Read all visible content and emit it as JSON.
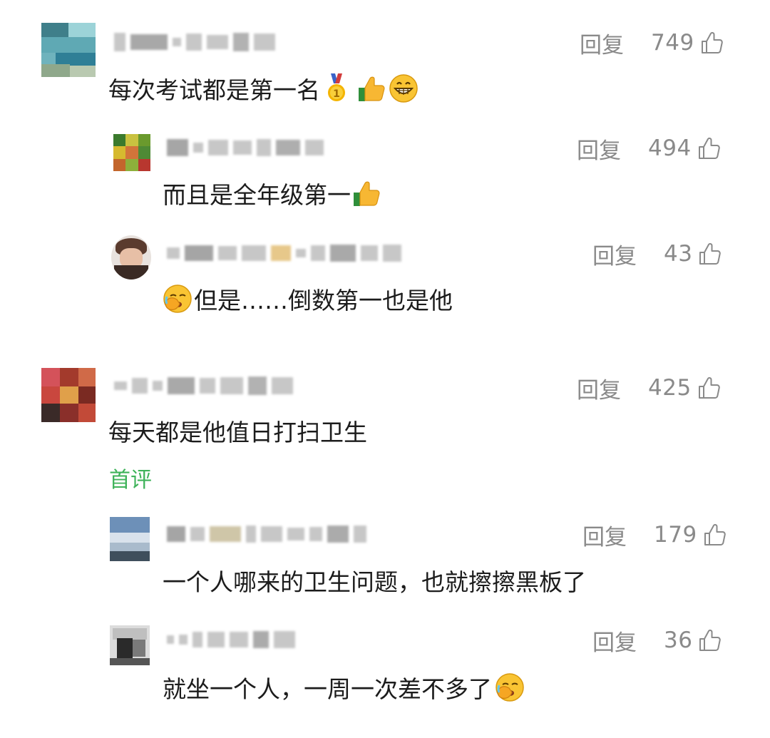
{
  "ui": {
    "reply_label": "回复",
    "first_comment_tag": "首评",
    "colors": {
      "meta_gray": "#8a8a8a",
      "tag_green": "#3fb35a",
      "text": "#1c1c1c"
    }
  },
  "comments": [
    {
      "text": "每次考试都是第一名",
      "likes": "749",
      "emojis": [
        "medal-icon",
        "thumbs-up-icon",
        "grin-icon"
      ],
      "replies": [
        {
          "text": "而且是全年级第一",
          "likes": "494",
          "emojis": [
            "thumbs-up-icon"
          ]
        },
        {
          "text": "但是……倒数第一也是他",
          "likes": "43",
          "emojis": [
            "facepalm-icon"
          ]
        }
      ]
    },
    {
      "text": "每天都是他值日打扫卫生",
      "likes": "425",
      "tag": "首评",
      "replies": [
        {
          "text": "一个人哪来的卫生问题，也就擦擦黑板了",
          "likes": "179"
        },
        {
          "text": "就坐一个人，一周一次差不多了",
          "likes": "36",
          "emojis": [
            "facepalm-icon"
          ]
        }
      ]
    }
  ]
}
